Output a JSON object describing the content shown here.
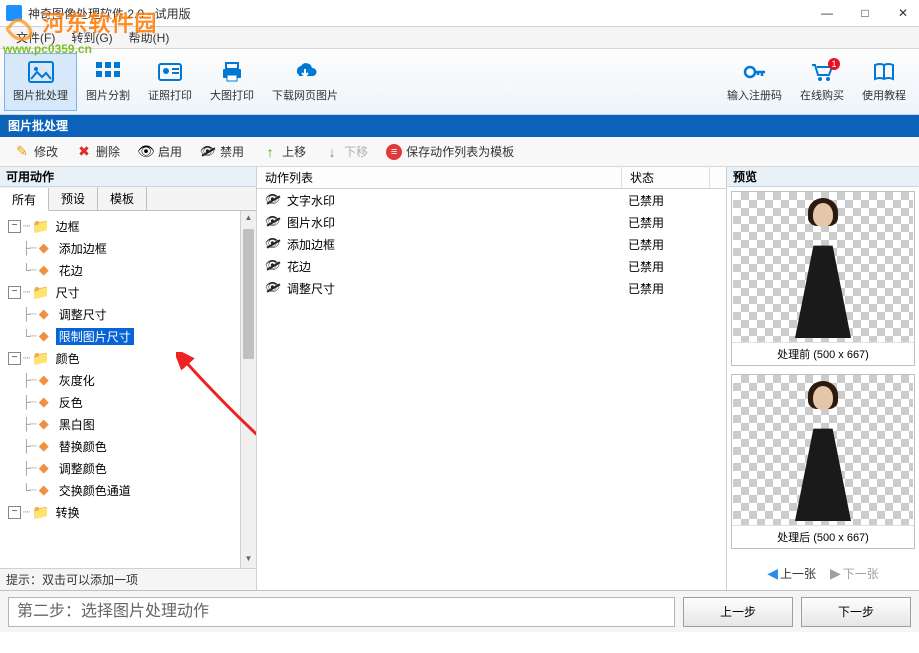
{
  "window": {
    "title": "神奇图像处理软件 2.0 - 试用版"
  },
  "watermark": {
    "site": "河东软件园",
    "url": "www.pc0359.cn"
  },
  "menubar": {
    "file": "文件(F)",
    "goto": "转到(G)",
    "help": "帮助(H)"
  },
  "toolbar": {
    "batch": "图片批处理",
    "split": "图片分割",
    "idprint": "证照打印",
    "bigprint": "大图打印",
    "download": "下载网页图片",
    "regcode": "输入注册码",
    "buy": "在线购买",
    "tutorial": "使用教程"
  },
  "module_header": "图片批处理",
  "actionbar": {
    "edit": "修改",
    "delete": "删除",
    "enable": "启用",
    "disable": "禁用",
    "moveup": "上移",
    "movedown": "下移",
    "save_template": "保存动作列表为模板"
  },
  "left": {
    "header": "可用动作",
    "tabs": {
      "all": "所有",
      "preset": "预设",
      "template": "模板"
    },
    "tree": {
      "border": "边框",
      "add_border": "添加边框",
      "lace": "花边",
      "size": "尺寸",
      "resize": "调整尺寸",
      "limit_size": "限制图片尺寸",
      "color": "颜色",
      "grayscale": "灰度化",
      "invert": "反色",
      "bw": "黑白图",
      "replace_color": "替换颜色",
      "adjust_color": "调整颜色",
      "swap_channels": "交换颜色通道",
      "transform": "转换"
    },
    "hint": "提示：双击可以添加一项"
  },
  "center": {
    "col_action": "动作列表",
    "col_status": "状态",
    "rows": [
      {
        "name": "文字水印",
        "status": "已禁用"
      },
      {
        "name": "图片水印",
        "status": "已禁用"
      },
      {
        "name": "添加边框",
        "status": "已禁用"
      },
      {
        "name": "花边",
        "status": "已禁用"
      },
      {
        "name": "调整尺寸",
        "status": "已禁用"
      }
    ]
  },
  "preview": {
    "header": "预览",
    "before": "处理前 (500 x 667)",
    "after": "处理后 (500 x 667)",
    "prev": "上一张",
    "next": "下一张"
  },
  "step": {
    "text": "第二步：选择图片处理动作",
    "prev_btn": "上一步",
    "next_btn": "下一步"
  }
}
